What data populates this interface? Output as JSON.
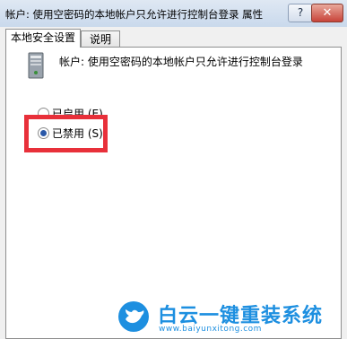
{
  "window": {
    "title": "帐户: 使用空密码的本地帐户只允许进行控制台登录 属性",
    "help_button": "?",
    "close_button": "✕"
  },
  "tabs": [
    {
      "label": "本地安全设置",
      "active": true
    },
    {
      "label": "说明",
      "active": false
    }
  ],
  "policy": {
    "icon": "computer-icon",
    "label": "帐户: 使用空密码的本地帐户只允许进行控制台登录"
  },
  "options": [
    {
      "label": "已启用 (E)",
      "checked": false
    },
    {
      "label": "已禁用 (S)",
      "checked": true
    }
  ],
  "highlight_color": "#e8303a",
  "watermark": {
    "title": "白云一键重装系统",
    "url": "www.baiyunxitong.com",
    "brand_color": "#1d8fe0"
  }
}
